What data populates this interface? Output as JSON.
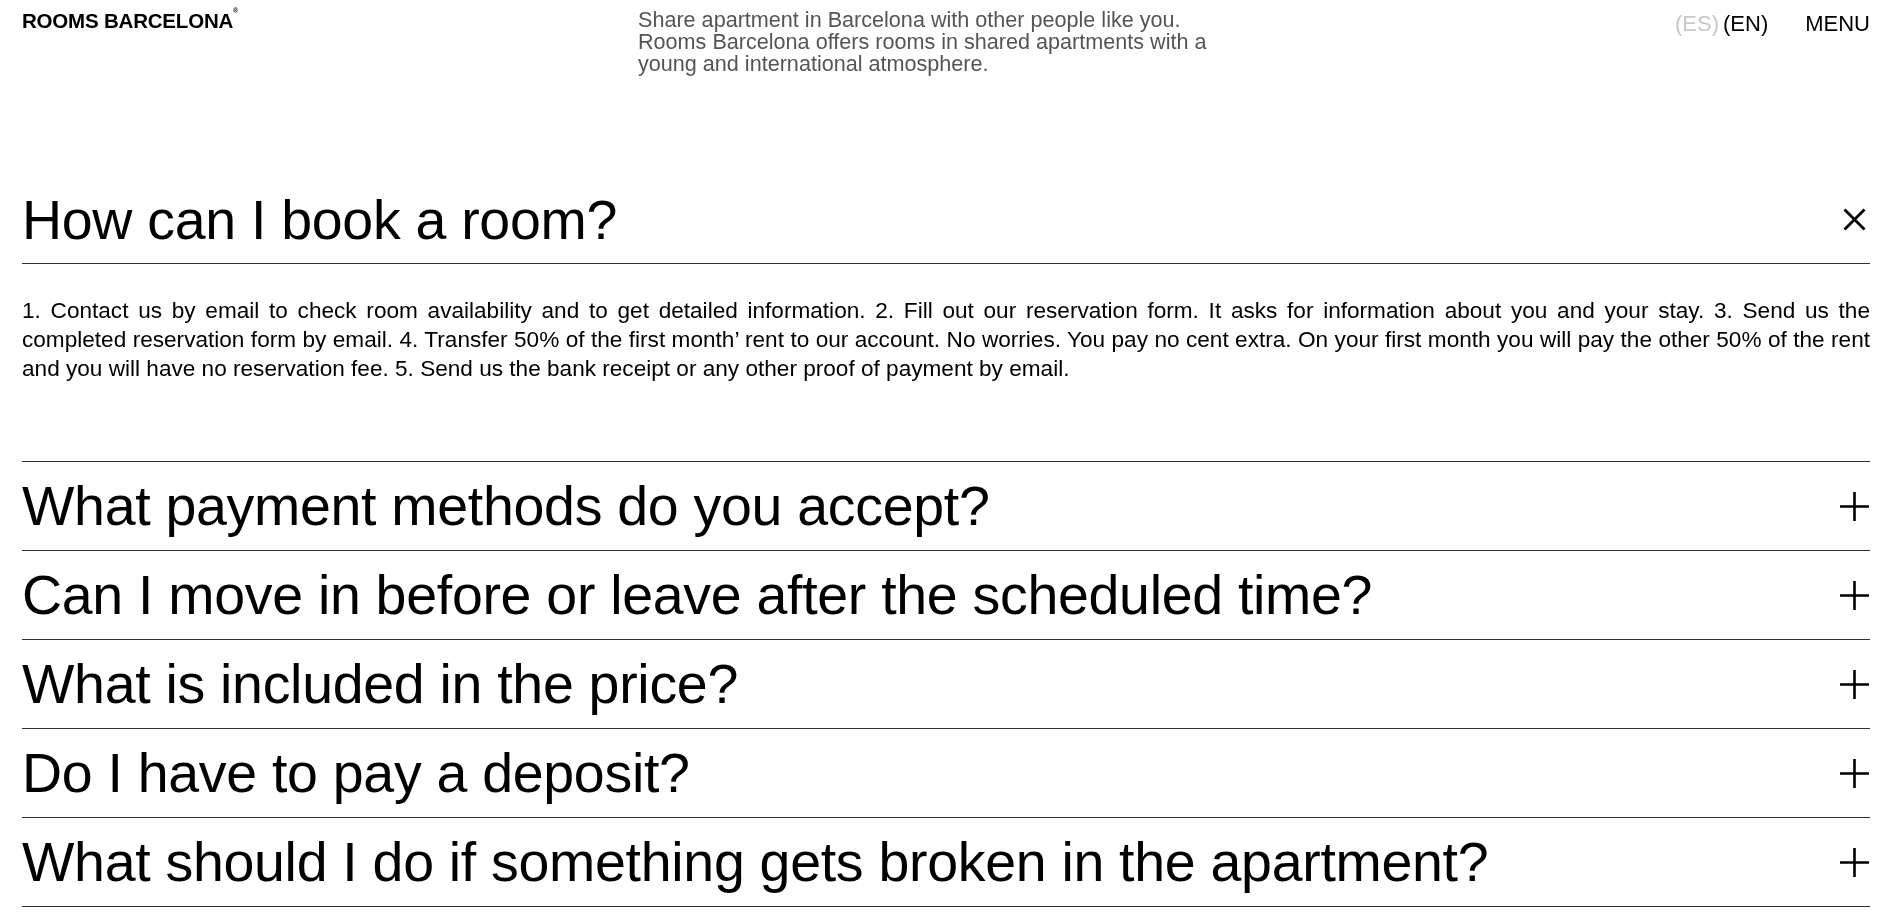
{
  "header": {
    "logo": "ROOMS BARCELONA$^{®}$",
    "tagline": "Share apartment in Barcelona with other people like you. Rooms Barcelona offers rooms in shared apartments with a young and international atmosphere.",
    "languages": [
      {
        "label": "(ES)",
        "selected": false
      },
      {
        "label": "(EN)",
        "selected": true
      }
    ],
    "menu": "MENU"
  },
  "faq": [
    {
      "question": "How can I book a room?",
      "expanded": true,
      "answer": "1. Contact us by email to check room availability and to get detailed information. 2. Fill out our reservation form. It asks for information about you and your stay. 3. Send us the completed reservation form by email. 4. Transfer 50% of the first month’ rent to our account. No worries. You pay no cent extra. On your first month you will pay the other 50% of the rent and you will have no reservation fee. 5. Send us the bank receipt or any other proof of payment by email."
    },
    {
      "question": "What payment methods do you accept?",
      "expanded": false
    },
    {
      "question": "Can I move in before or leave after the scheduled time?",
      "expanded": false
    },
    {
      "question": "What is included in the price?",
      "expanded": false
    },
    {
      "question": "Do I have to pay a deposit?",
      "expanded": false
    },
    {
      "question": "What should I do if something gets broken in the apartment?",
      "expanded": false
    }
  ]
}
